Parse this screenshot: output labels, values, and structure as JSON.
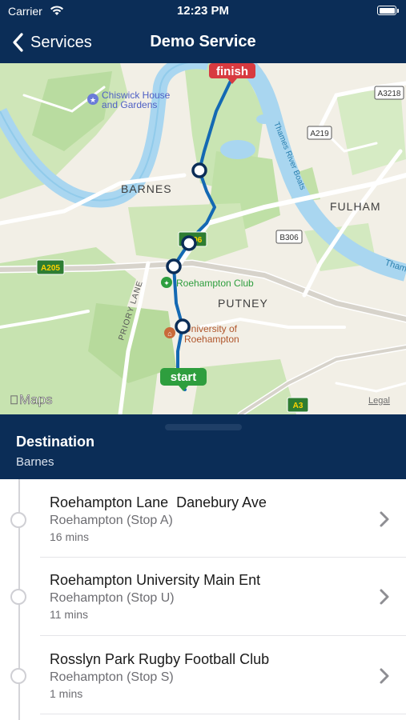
{
  "status_bar": {
    "carrier": "Carrier",
    "time": "12:23 PM"
  },
  "nav": {
    "back_label": "Services",
    "title": "Demo Service"
  },
  "map": {
    "place_labels": {
      "barnes": "BARNES",
      "fulham": "FULHAM",
      "putney": "PUTNEY",
      "priory_lane": "PRIORY LANE",
      "thames_river_boats": "Thames River Boats",
      "thames": "Tham"
    },
    "poi": {
      "chiswick": [
        "Chiswick House",
        "and Gardens"
      ],
      "roehampton_club": "Roehampton Club",
      "university": [
        "University of",
        "Roehampton"
      ]
    },
    "road_shields": {
      "a3218": "A3218",
      "a219": "A219",
      "b306": "B306",
      "a205": "A205",
      "a3": "A3",
      "a306": "306"
    },
    "route_markers": {
      "start": "start",
      "finish": "finish"
    },
    "attribution": {
      "maps_logo": "Maps",
      "legal": "Legal"
    },
    "colors": {
      "route": "#1469b3",
      "start_marker": "#2e9e3e",
      "finish_marker": "#d83a40",
      "river": "#a9d6f0"
    }
  },
  "destination": {
    "label": "Destination",
    "value": "Barnes"
  },
  "stops": [
    {
      "name": "Roehampton Lane  Danebury Ave",
      "area": "Roehampton (Stop A)",
      "eta": "16 mins"
    },
    {
      "name": "Roehampton University Main Ent",
      "area": "Roehampton (Stop U)",
      "eta": "11 mins"
    },
    {
      "name": "Rosslyn Park Rugby Football Club",
      "area": "Roehampton (Stop S)",
      "eta": "1 mins"
    }
  ]
}
